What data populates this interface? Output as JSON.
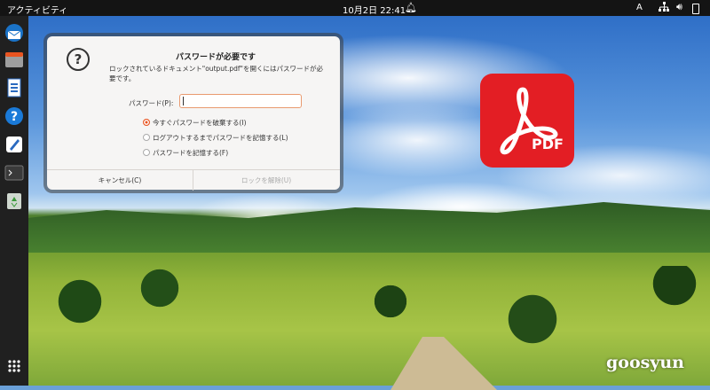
{
  "topbar": {
    "activities": "アクティビティ",
    "clock": "10月2日  22:41",
    "ime": "A"
  },
  "dock": {
    "apps": [
      "thunderbird-icon",
      "files-icon",
      "libreoffice-writer-icon",
      "help-icon",
      "text-editor-icon",
      "terminal-icon",
      "trash-icon"
    ],
    "show_apps": "show-apps-icon"
  },
  "dialog": {
    "title": "パスワードが必要です",
    "message": "ロックされているドキュメント\"output.pdf\"を開くにはパスワードが必要です。",
    "password_label": "パスワード(P):",
    "password_value": "",
    "options": [
      {
        "label": "今すぐパスワードを破棄する(I)",
        "selected": true
      },
      {
        "label": "ログアウトするまでパスワードを記憶する(L)",
        "selected": false
      },
      {
        "label": "パスワードを記憶する(F)",
        "selected": false
      }
    ],
    "cancel_label": "キャンセル(C)",
    "unlock_label": "ロックを解除(U)"
  },
  "pdf_logo_text": "PDF",
  "watermark": "goosyun",
  "colors": {
    "accent": "#e95420",
    "pdf_red": "#e31e24",
    "topbar": "#141414",
    "dock": "#202020"
  }
}
